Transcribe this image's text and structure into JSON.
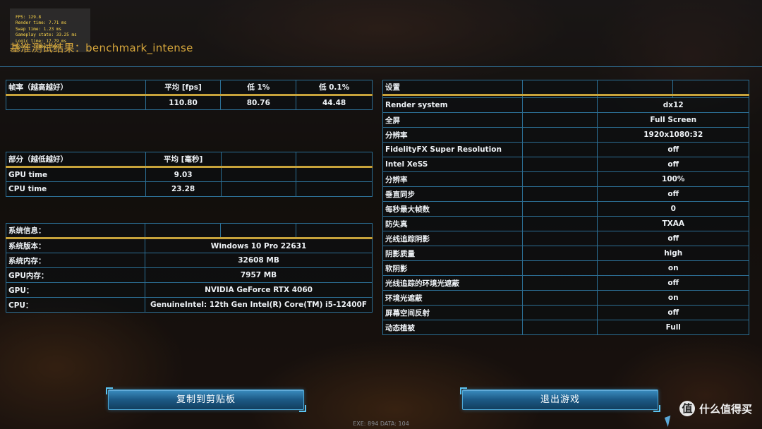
{
  "debug": {
    "lines": [
      "FPS: 129.8",
      "Render time: 7.71 ms",
      "Swap time: 1.23 ms",
      "Gameplay state: 33.25 ms",
      "Logic time: 17.79 ms",
      "Sound: 1080p/1080i"
    ]
  },
  "page_title": "基准测试结果：benchmark_intense",
  "fps_table": {
    "headers": [
      "帧率（越高越好）",
      "平均 [fps]",
      "低 1%",
      "低 0.1%"
    ],
    "values": [
      "",
      "110.80",
      "80.76",
      "44.48"
    ]
  },
  "parts_table": {
    "headers": [
      "部分（越低越好）",
      "平均 [毫秒]",
      "",
      ""
    ],
    "rows": [
      {
        "label": "GPU time",
        "value": "9.03"
      },
      {
        "label": "CPU time",
        "value": "23.28"
      }
    ]
  },
  "sys_table": {
    "header": "系统信息：",
    "rows": [
      {
        "label": "系统版本：",
        "value": "Windows 10 Pro 22631"
      },
      {
        "label": "系统内存：",
        "value": "32608 MB"
      },
      {
        "label": "GPU内存：",
        "value": "7957 MB"
      },
      {
        "label": "GPU：",
        "value": "NVIDIA GeForce RTX 4060"
      },
      {
        "label": "CPU：",
        "value": "GenuineIntel: 12th Gen Intel(R) Core(TM) i5-12400F"
      }
    ]
  },
  "settings_table": {
    "header": "设置",
    "rows": [
      {
        "label": "Render system",
        "value": "dx12"
      },
      {
        "label": "全屏",
        "value": "Full Screen"
      },
      {
        "label": "分辨率",
        "value": "1920x1080:32"
      },
      {
        "label": "FidelityFX Super Resolution",
        "value": "off"
      },
      {
        "label": "Intel XeSS",
        "value": "off"
      },
      {
        "label": "分辨率",
        "value": "100%"
      },
      {
        "label": "垂直同步",
        "value": "off"
      },
      {
        "label": "每秒最大帧数",
        "value": "0"
      },
      {
        "label": "防失真",
        "value": "TXAA"
      },
      {
        "label": "光线追踪阴影",
        "value": "off"
      },
      {
        "label": "阴影质量",
        "value": "high"
      },
      {
        "label": "软阴影",
        "value": "on"
      },
      {
        "label": "光线追踪的环境光遮蔽",
        "value": "off"
      },
      {
        "label": "环境光遮蔽",
        "value": "on"
      },
      {
        "label": "屏幕空间反射",
        "value": "off"
      },
      {
        "label": "动态植被",
        "value": "Full"
      }
    ]
  },
  "buttons": {
    "copy": "复制到剪贴板",
    "exit": "退出游戏"
  },
  "status_bar": "EXE: 894 DATA: 104",
  "watermark": {
    "logo": "值",
    "text": "什么值得买"
  }
}
